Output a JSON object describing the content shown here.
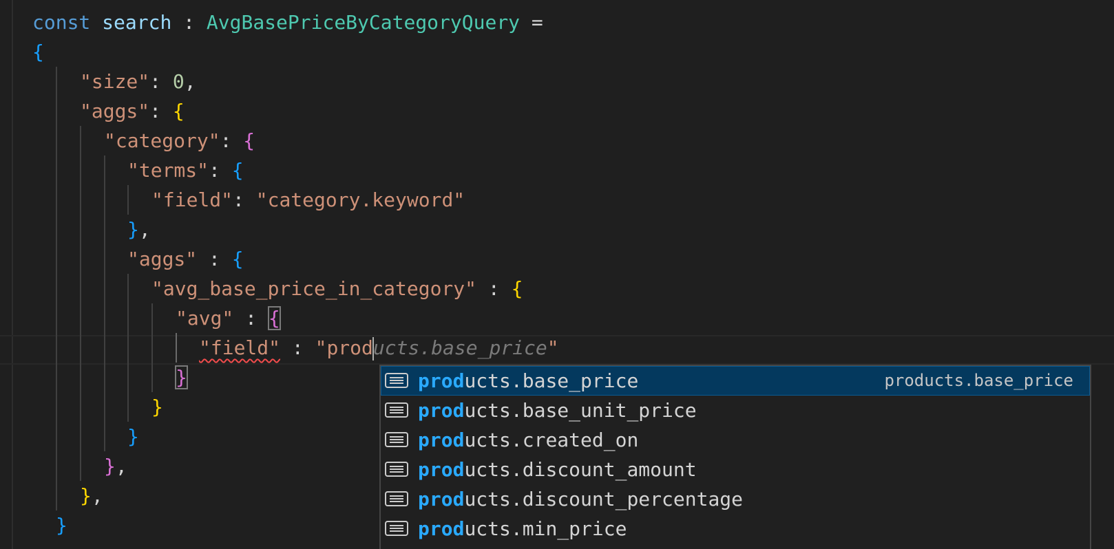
{
  "code": {
    "l1": {
      "kw": "const",
      "var": "search",
      "colon": " : ",
      "type": "AvgBasePriceByCategoryQuery",
      "eq": " ="
    },
    "l2": {
      "brace": "{"
    },
    "l3": {
      "key": "\"size\"",
      "colon": ": ",
      "val": "0",
      "comma": ","
    },
    "l4": {
      "key": "\"aggs\"",
      "colon": ": ",
      "brace": "{"
    },
    "l5": {
      "key": "\"category\"",
      "colon": ": ",
      "brace": "{"
    },
    "l6": {
      "key": "\"terms\"",
      "colon": ": ",
      "brace": "{"
    },
    "l7": {
      "key": "\"field\"",
      "colon": ": ",
      "val": "\"category.keyword\""
    },
    "l8": {
      "brace": "}",
      "comma": ","
    },
    "l9": {
      "key": "\"aggs\"",
      "colon": " : ",
      "brace": "{"
    },
    "l10": {
      "key": "\"avg_base_price_in_category\"",
      "colon": " : ",
      "brace": "{"
    },
    "l11": {
      "key": "\"avg\"",
      "colon": " : ",
      "brace": "{"
    },
    "l12": {
      "key": "\"field\"",
      "colon": " : ",
      "typed": "\"prod",
      "ghost": "ucts.base_price",
      "close": "\""
    },
    "l13": {
      "brace": "}"
    },
    "l14": {
      "brace": "}"
    },
    "l15": {
      "brace": "}"
    },
    "l16": {
      "brace": "}",
      "comma": ","
    },
    "l17": {
      "brace": "}",
      "comma": ","
    },
    "l18": {
      "brace": "}"
    }
  },
  "suggest": {
    "match_prefix": "prod",
    "selected_detail": "products.base_price",
    "items": [
      {
        "match": "prod",
        "rest": "ucts.base_price",
        "icon": "text-icon"
      },
      {
        "match": "prod",
        "rest": "ucts.base_unit_price",
        "icon": "text-icon"
      },
      {
        "match": "prod",
        "rest": "ucts.created_on",
        "icon": "text-icon"
      },
      {
        "match": "prod",
        "rest": "ucts.discount_amount",
        "icon": "text-icon"
      },
      {
        "match": "prod",
        "rest": "ucts.discount_percentage",
        "icon": "text-icon"
      },
      {
        "match": "prod",
        "rest": "ucts.min_price",
        "icon": "text-icon"
      }
    ]
  },
  "colors": {
    "background": "#1f1f1f",
    "selected_item": "#04395e",
    "match_highlight": "#2aaaff"
  }
}
